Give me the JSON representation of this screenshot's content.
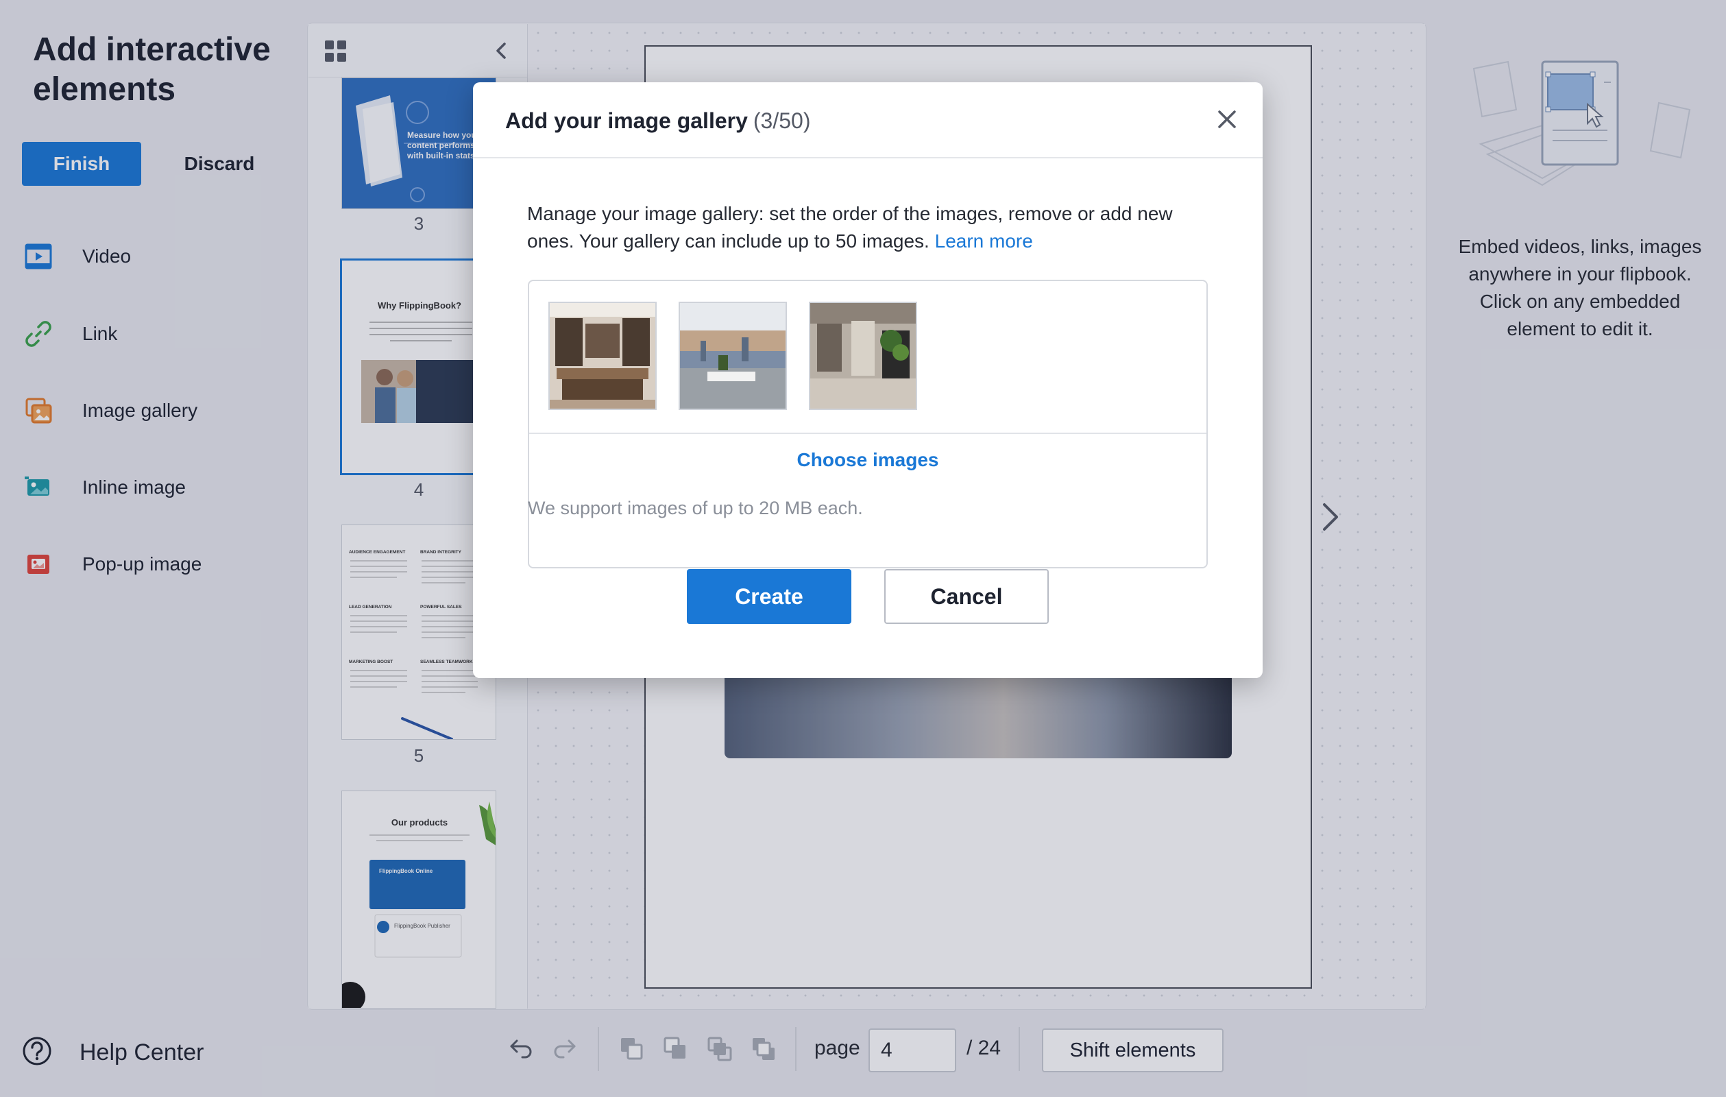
{
  "sidebar": {
    "title": "Add interactive elements",
    "finish_label": "Finish",
    "discard_label": "Discard",
    "items": [
      {
        "label": "Video",
        "icon": "video-icon",
        "color": "#1a78d6"
      },
      {
        "label": "Link",
        "icon": "link-icon",
        "color": "#3aa14a"
      },
      {
        "label": "Image gallery",
        "icon": "image-gallery-icon",
        "color": "#e27b2a"
      },
      {
        "label": "Inline image",
        "icon": "inline-image-icon",
        "color": "#1e9aa8"
      },
      {
        "label": "Pop-up image",
        "icon": "popup-image-icon",
        "color": "#e0443a"
      }
    ],
    "help_label": "Help Center"
  },
  "thumbnails": {
    "pages": [
      {
        "number": "3",
        "text": "Measure how your content performs with built-in stats."
      },
      {
        "number": "4",
        "title": "Why FlippingBook?",
        "selected": true
      },
      {
        "number": "5",
        "headings": [
          "AUDIENCE ENGAGEMENT",
          "BRAND INTEGRITY",
          "LEAD GENERATION",
          "POWERFUL SALES",
          "MARKETING BOOST",
          "SEAMLESS TEAMWORK"
        ]
      },
      {
        "title": "Our products",
        "card1": "FlippingBook Online",
        "card2": "FlippingBook Publisher"
      }
    ]
  },
  "right_panel": {
    "info_text": "Embed videos, links, images anywhere in your flipbook. Click on any embedded element to edit it."
  },
  "toolbar": {
    "page_label": "page",
    "page_value": "4",
    "page_total": "/ 24",
    "shift_label": "Shift elements"
  },
  "modal": {
    "title": "Add your image gallery",
    "count": "(3/50)",
    "description": "Manage your image gallery: set the order of the images, remove or add new ones. Your gallery can include up to 50 images.",
    "learn_more": "Learn more",
    "choose_images": "Choose images",
    "support_note": "We support images of up to 20 MB each.",
    "create_label": "Create",
    "cancel_label": "Cancel"
  },
  "colors": {
    "accent": "#1a78d6",
    "background": "#e9eaef"
  }
}
